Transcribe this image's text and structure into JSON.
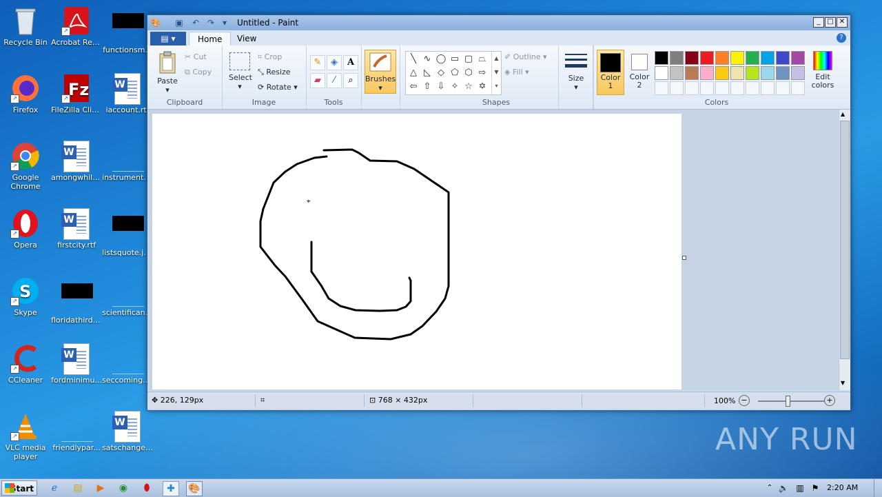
{
  "desktop": {
    "icons": [
      {
        "label": "Recycle Bin",
        "icon": "recycle-bin-icon"
      },
      {
        "label": "Acrobat Reader DC",
        "icon": "acrobat-icon"
      },
      {
        "label": "functionsm...",
        "icon": "black-image-icon"
      },
      {
        "label": "Firefox",
        "icon": "firefox-icon"
      },
      {
        "label": "FileZilla Client",
        "icon": "filezilla-icon"
      },
      {
        "label": "iaccount.rtf",
        "icon": "word-document-icon"
      },
      {
        "label": "Google Chrome",
        "icon": "chrome-icon"
      },
      {
        "label": "amongwhile....",
        "icon": "word-document-icon"
      },
      {
        "label": "instruments....",
        "icon": "blank-file-icon"
      },
      {
        "label": "Opera",
        "icon": "opera-icon"
      },
      {
        "label": "firstcity.rtf",
        "icon": "word-document-icon"
      },
      {
        "label": "listsquote.jpg",
        "icon": "black-image-icon"
      },
      {
        "label": "Skype",
        "icon": "skype-icon"
      },
      {
        "label": "floridathird.jpg",
        "icon": "black-image-icon"
      },
      {
        "label": "scientificant...",
        "icon": "blank-file-icon"
      },
      {
        "label": "CCleaner",
        "icon": "ccleaner-icon"
      },
      {
        "label": "fordminimu...",
        "icon": "word-document-icon"
      },
      {
        "label": "seccoming.p...",
        "icon": "blank-file-icon"
      },
      {
        "label": "VLC media player",
        "icon": "vlc-icon"
      },
      {
        "label": "friendlypar...",
        "icon": "blank-file-icon"
      },
      {
        "label": "satschange.rtf",
        "icon": "word-document-icon"
      }
    ]
  },
  "window": {
    "title": "Untitled - Paint",
    "tabs": [
      "Home",
      "View"
    ],
    "active_tab": "Home",
    "ribbon": {
      "clipboard": {
        "label": "Clipboard",
        "paste": "Paste",
        "cut": "Cut",
        "copy": "Copy"
      },
      "image": {
        "label": "Image",
        "select": "Select",
        "crop": "Crop",
        "resize": "Resize",
        "rotate": "Rotate"
      },
      "tools": {
        "label": "Tools"
      },
      "brushes": {
        "label": "Brushes"
      },
      "shapes": {
        "label": "Shapes",
        "outline": "Outline",
        "fill": "Fill"
      },
      "size": {
        "label": "Size"
      },
      "color1": {
        "label": "Color 1",
        "value": "#000000"
      },
      "color2": {
        "label": "Color 2",
        "value": "#ffffff"
      },
      "colors": {
        "label": "Colors",
        "edit": "Edit colors"
      }
    },
    "palette": [
      "#000000",
      "#7f7f7f",
      "#880015",
      "#ed1c24",
      "#ff7f27",
      "#fff200",
      "#22b14c",
      "#00a2e8",
      "#3f48cc",
      "#a349a4",
      "#ffffff",
      "#c3c3c3",
      "#b97a57",
      "#ffaec9",
      "#ffc90e",
      "#efe4b0",
      "#b5e61d",
      "#99d9ea",
      "#7092be",
      "#c8bfe7",
      "",
      "",
      "",
      "",
      "",
      "",
      "",
      "",
      "",
      ""
    ],
    "status": {
      "cursor_pos": "226, 129px",
      "canvas_size": "768 × 432px",
      "zoom": "100%"
    }
  },
  "taskbar": {
    "start": "Start",
    "clock": "2:20 AM"
  },
  "watermark": "ANY RUN"
}
